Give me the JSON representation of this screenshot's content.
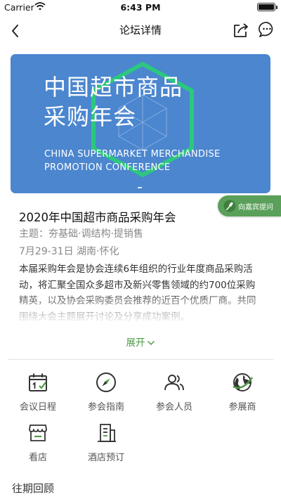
{
  "status_bar": {
    "carrier": "Carrier",
    "time": "6:43 PM"
  },
  "nav": {
    "title": "论坛详情"
  },
  "banner": {
    "title_lines": [
      "中国超市商品",
      "采购年会"
    ],
    "subtitle_lines": [
      "CHINA SUPERMARKET MERCHANDISE",
      "PROMOTION CONFERENCE"
    ],
    "background_color": "#4b86cf",
    "accent_color": "#2cc77f"
  },
  "ask_button": {
    "label": "向嘉宾提问",
    "color": "#5aa05a"
  },
  "forum": {
    "title": "2020年中国超市商品采购年会",
    "theme": "主题：夯基础·调结构·提销售",
    "date_location": "7月29-31日 湖南·怀化",
    "description": "本届采购年会是协会连续6年组织的行业年度商品采购活动，将汇聚全国众多超市及新兴零售领域的约700位采购精英，以及协会采购委员会推荐的近百个优质厂商。共同围绕大会主题展开讨论及分享成功案例。"
  },
  "expand": {
    "label": "展开"
  },
  "menu": {
    "items": [
      {
        "label": "会议日程",
        "icon": "calendar-icon"
      },
      {
        "label": "参会指南",
        "icon": "compass-icon"
      },
      {
        "label": "参会人员",
        "icon": "people-icon"
      },
      {
        "label": "参展商",
        "icon": "globe-icon"
      },
      {
        "label": "看店",
        "icon": "shop-icon"
      },
      {
        "label": "酒店预订",
        "icon": "hotel-icon"
      }
    ]
  },
  "section": {
    "past_title": "往期回顾"
  },
  "colors": {
    "accent_green": "#4f9a45",
    "icon_dark": "#333333"
  }
}
